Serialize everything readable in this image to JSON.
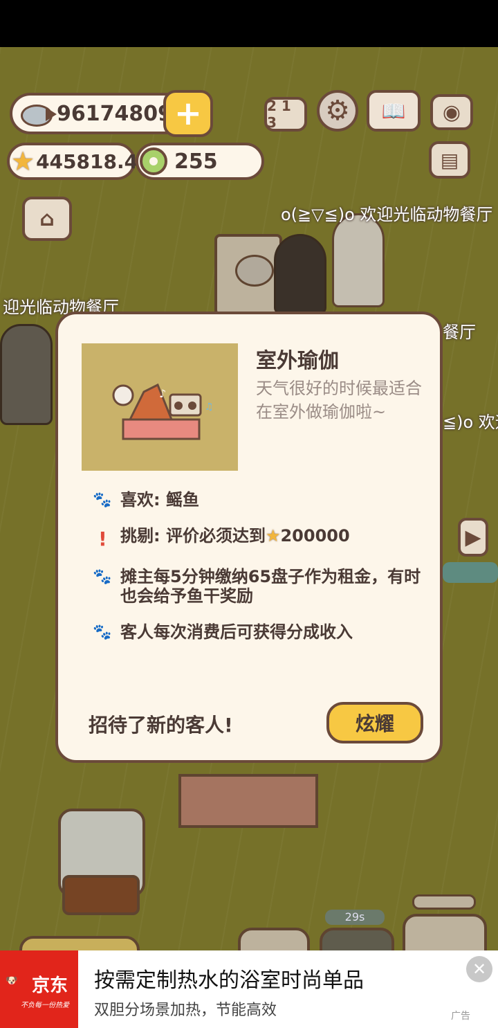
{
  "hud": {
    "fish_count": "96174809",
    "rating": "445818.4",
    "coins": "255",
    "plus_label": "+"
  },
  "scene": {
    "banner_1": "o(≧▽≦)o 欢迎光临动物餐厅",
    "banner_2": "迎光临动物餐厅",
    "banner_3": "餐厅",
    "banner_4": "≦)o 欢迎",
    "timer": "29s"
  },
  "modal": {
    "title": "室外瑜伽",
    "description": "天气很好的时候最适合在室外做瑜伽啦~",
    "likes": "喜欢: 鳐鱼",
    "picky_prefix": "挑剔: 评价必须达到",
    "picky_value": "200000",
    "rent": "摊主每5分钟缴纳65盘子作为租金，有时也会给予鱼干奖励",
    "revenue": "客人每次消费后可获得分成收入",
    "served": "招待了新的客人!",
    "share_button": "炫耀"
  },
  "ad": {
    "brand": "京东",
    "slogan": "不负每一份热爱",
    "title": "按需定制热水的浴室时尚单品",
    "subtitle": "双胆分场景加热，节能高效",
    "tag": "广告"
  }
}
